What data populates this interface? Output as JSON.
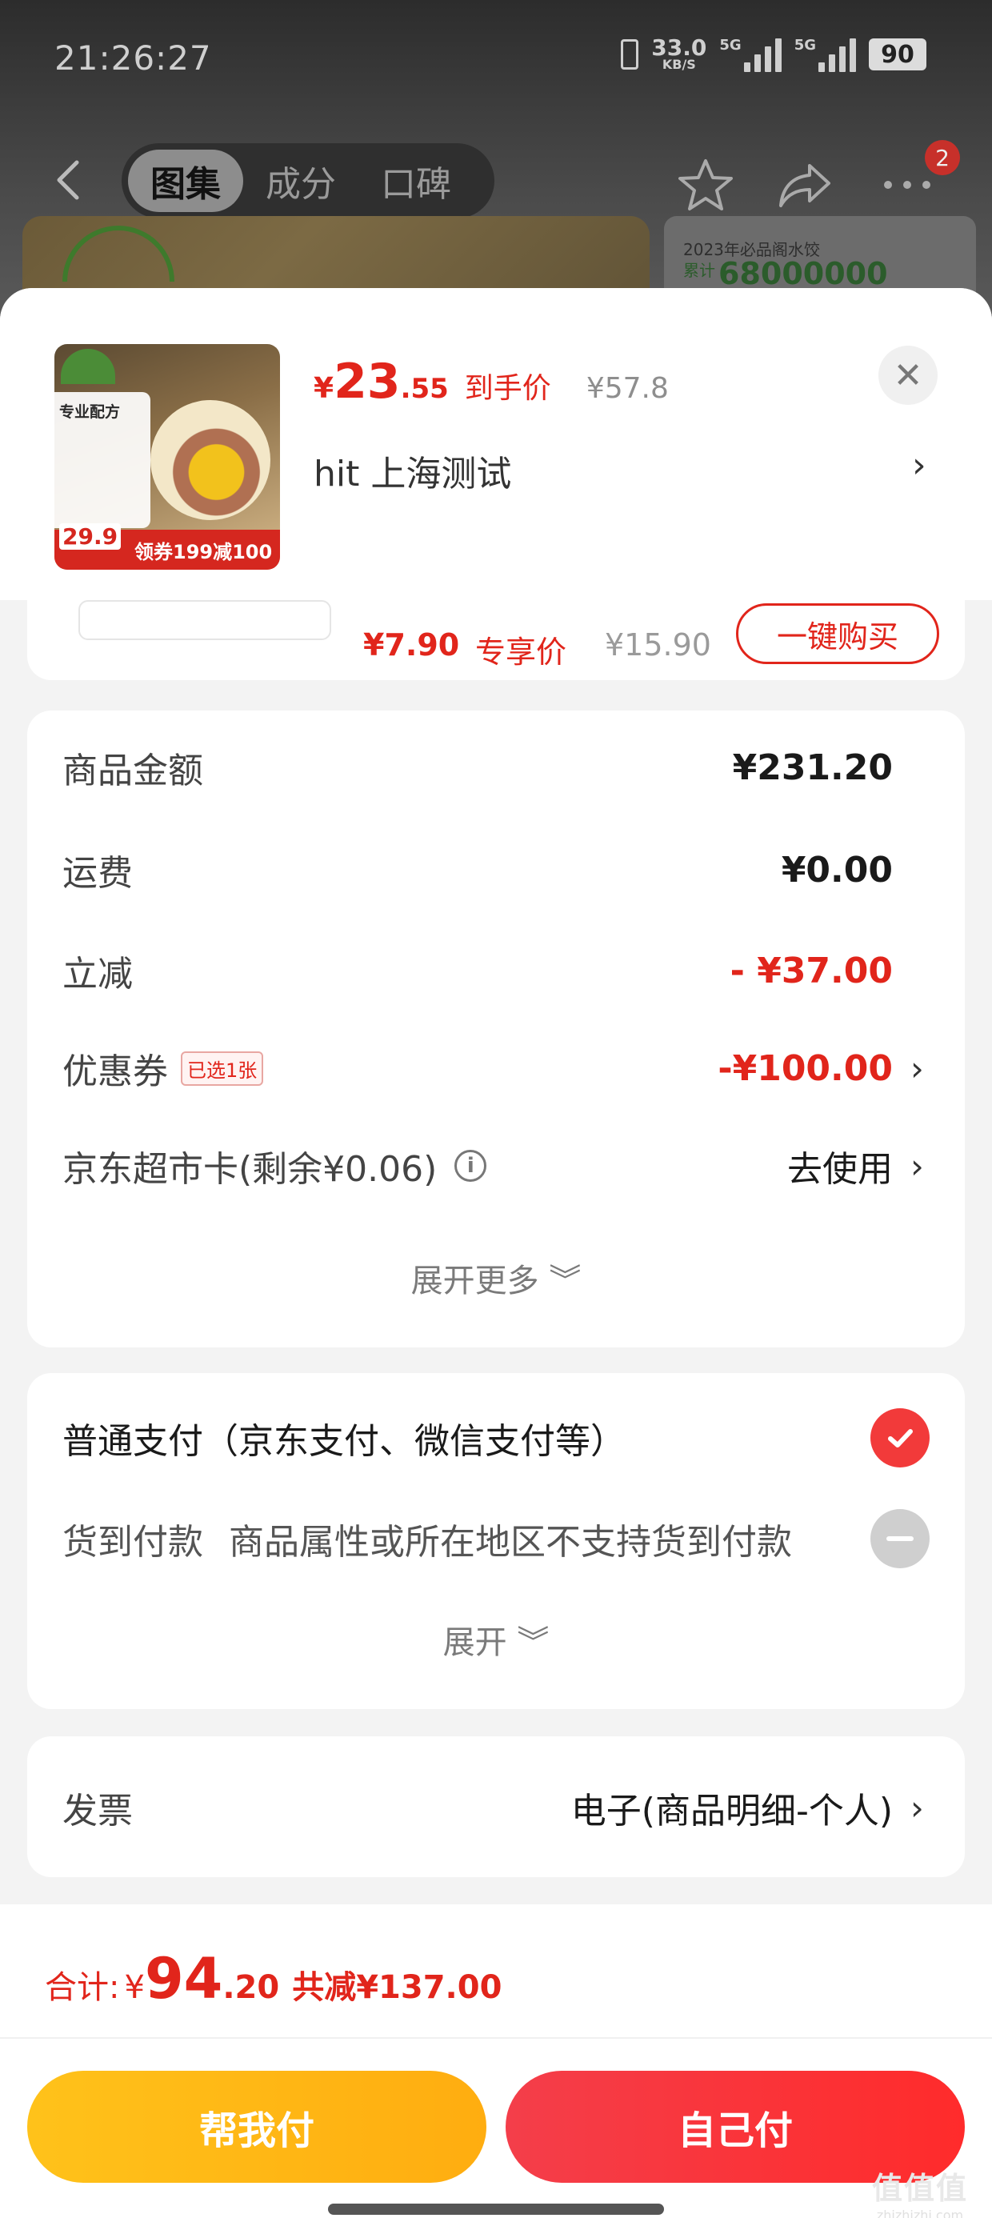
{
  "status_bar": {
    "time": "21:26:27",
    "net_speed": "33.0",
    "net_unit": "KB/S",
    "sig1_label": "5G",
    "sig2_label": "5G",
    "battery": "90"
  },
  "nav": {
    "tabs": [
      "图集",
      "成分",
      "口碑"
    ],
    "active_tab": 0,
    "cart_badge": "2"
  },
  "hero_right": {
    "line1": "2023年必品阁水饺",
    "line2": "累计",
    "line3": "68000000"
  },
  "product": {
    "thumb": {
      "card_title": "专业配方",
      "ref_price": "29.9",
      "coupon_text": "领券199减100"
    },
    "currency": "¥",
    "price_int": "23",
    "price_dec": ".55",
    "price_tag": "到手价",
    "orig_price": "¥57.8",
    "address": "hit  上海测试",
    "arrow": "›",
    "close": "✕"
  },
  "peek_item": {
    "price": "¥7.90",
    "tag": "专享价",
    "orig": "¥15.90",
    "button": "一键购买"
  },
  "amounts": {
    "rows": [
      {
        "label": "商品金额",
        "value": "¥231.20"
      },
      {
        "label": "运费",
        "value": "¥0.00"
      },
      {
        "label": "立减",
        "value": "- ¥37.00"
      },
      {
        "label": "优惠券",
        "chip": "已选1张",
        "value": "-¥100.00",
        "arrow": "›"
      },
      {
        "label": "京东超市卡(剩余¥0.06)",
        "info": "i",
        "value": "去使用",
        "arrow": "›"
      }
    ],
    "expand_more": "展开更多 ︾"
  },
  "payment": {
    "normal": "普通支付（京东支付、微信支付等）",
    "cod_title": "货到付款",
    "cod_note": "商品属性或所在地区不支持货到付款",
    "expand": "展开 ︾"
  },
  "invoice": {
    "label": "发票",
    "value": "电子(商品明细-个人)",
    "arrow": "›"
  },
  "footer": {
    "total_label": "合计:",
    "total_cur": "¥",
    "total_int": "94",
    "total_dec": ".20",
    "total_save": "共减¥137.00",
    "btn_help": "帮我付",
    "btn_self": "自己付",
    "watermark": "值值值",
    "watermark_url": "zhizhizhi.com"
  }
}
